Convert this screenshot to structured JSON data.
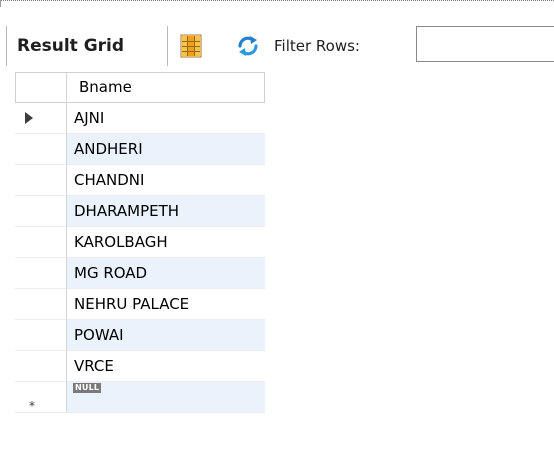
{
  "toolbar": {
    "result_grid_label": "Result Grid",
    "filter_label": "Filter Rows:",
    "filter_value": "",
    "icons": {
      "grid_view": "grid-layout-icon",
      "refresh": "refresh-icon"
    }
  },
  "grid": {
    "columns": [
      "Bname"
    ],
    "rows": [
      {
        "bname": "AJNI"
      },
      {
        "bname": "ANDHERI"
      },
      {
        "bname": "CHANDNI"
      },
      {
        "bname": "DHARAMPETH"
      },
      {
        "bname": "KAROLBAGH"
      },
      {
        "bname": "MG ROAD"
      },
      {
        "bname": "NEHRU PALACE"
      },
      {
        "bname": "POWAI"
      },
      {
        "bname": "VRCE"
      }
    ],
    "new_row": {
      "marker": "*",
      "null_label": "NULL"
    }
  },
  "colors": {
    "alt_row": "#eaf2fb",
    "grid_icon_orange": "#f0a020",
    "refresh_blue": "#1f7fd0"
  }
}
